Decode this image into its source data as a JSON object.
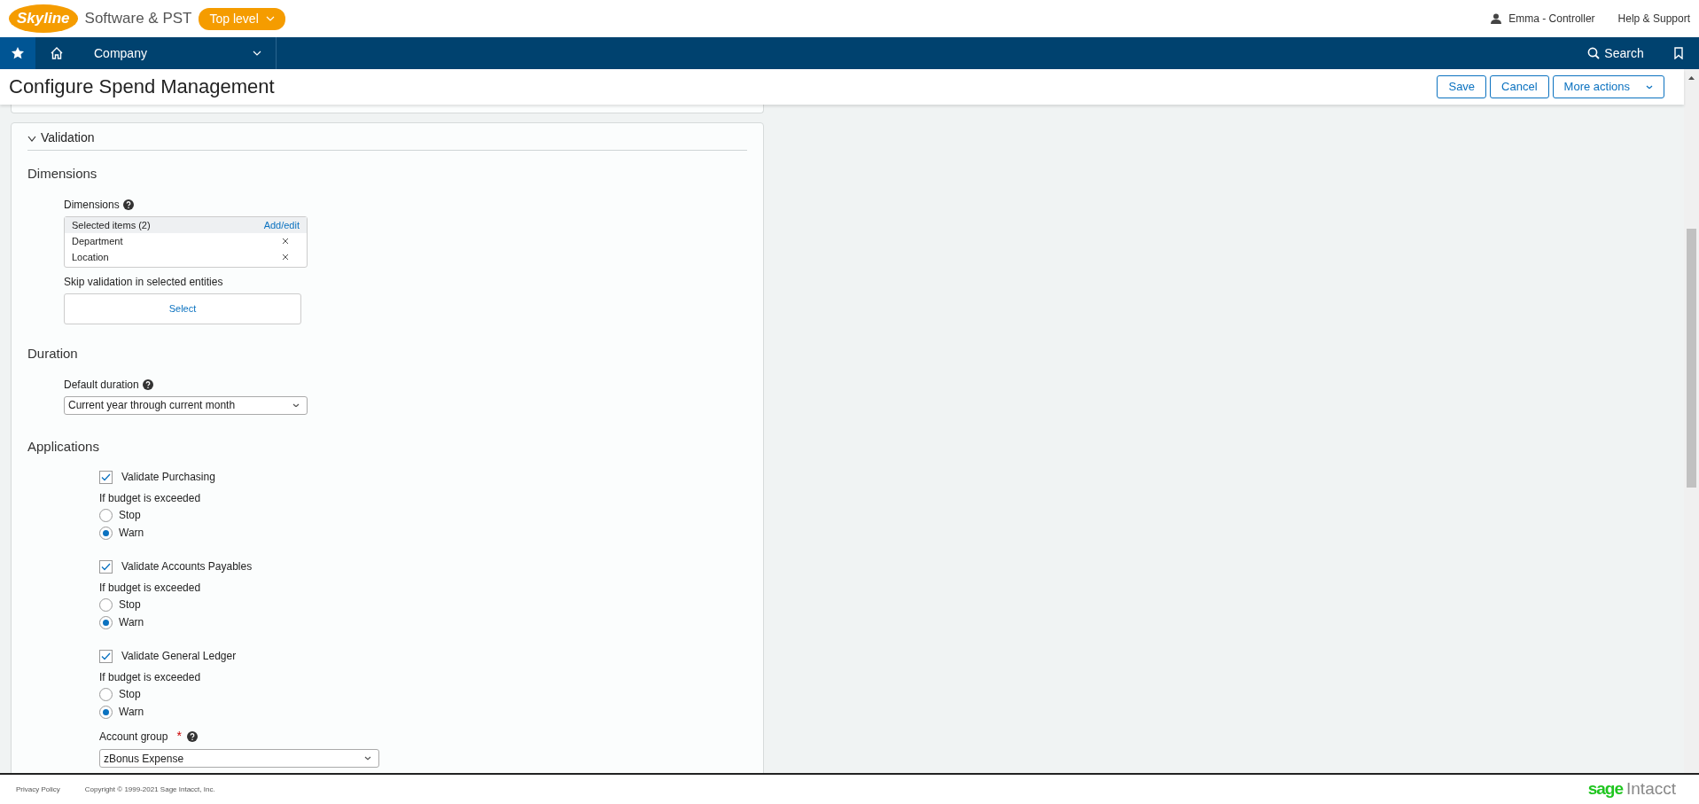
{
  "header": {
    "logo": "Skyline",
    "company": "Software & PST",
    "entity": "Top level",
    "user": "Emma - Controller",
    "help": "Help & Support"
  },
  "nav": {
    "module": "Company",
    "search": "Search"
  },
  "page": {
    "title": "Configure Spend Management",
    "actions": [
      {
        "label": "Save",
        "menu": false
      },
      {
        "label": "Cancel",
        "menu": false
      },
      {
        "label": "More actions",
        "menu": true
      }
    ]
  },
  "panel": {
    "title": "Validation",
    "expanded": true,
    "sections": [
      {
        "title": "Dimensions",
        "fields": [
          {
            "kind": "multiselect",
            "label": "Dimensions",
            "help": true,
            "header": "Selected items (2)",
            "action": "Add/edit",
            "items": [
              "Department",
              "Location"
            ]
          },
          {
            "kind": "picker",
            "label": "Skip validation in selected entities",
            "button": "Select"
          }
        ]
      },
      {
        "title": "Duration",
        "fields": [
          {
            "kind": "select",
            "label": "Default duration",
            "help": true,
            "value": "Current year through current month"
          }
        ]
      },
      {
        "title": "Applications",
        "fields": [
          {
            "kind": "checkgroup",
            "label": "Validate Purchasing",
            "checked": true,
            "question": "If budget is exceeded",
            "options": [
              {
                "label": "Stop",
                "selected": false
              },
              {
                "label": "Warn",
                "selected": true
              }
            ]
          },
          {
            "kind": "checkgroup",
            "label": "Validate Accounts Payables",
            "checked": true,
            "question": "If budget is exceeded",
            "options": [
              {
                "label": "Stop",
                "selected": false
              },
              {
                "label": "Warn",
                "selected": true
              }
            ]
          },
          {
            "kind": "checkgroup",
            "label": "Validate General Ledger",
            "checked": true,
            "question": "If budget is exceeded",
            "options": [
              {
                "label": "Stop",
                "selected": false
              },
              {
                "label": "Warn",
                "selected": true
              }
            ]
          },
          {
            "kind": "select",
            "label": "Account group",
            "required_mark": "*",
            "help": true,
            "value": "zBonus Expense"
          }
        ]
      }
    ]
  },
  "footer": {
    "link": "Privacy Policy",
    "copyright": "Copyright © 1999-2021 Sage Intacct, Inc.",
    "brand": {
      "primary": "sage",
      "secondary": "Intacct"
    }
  }
}
